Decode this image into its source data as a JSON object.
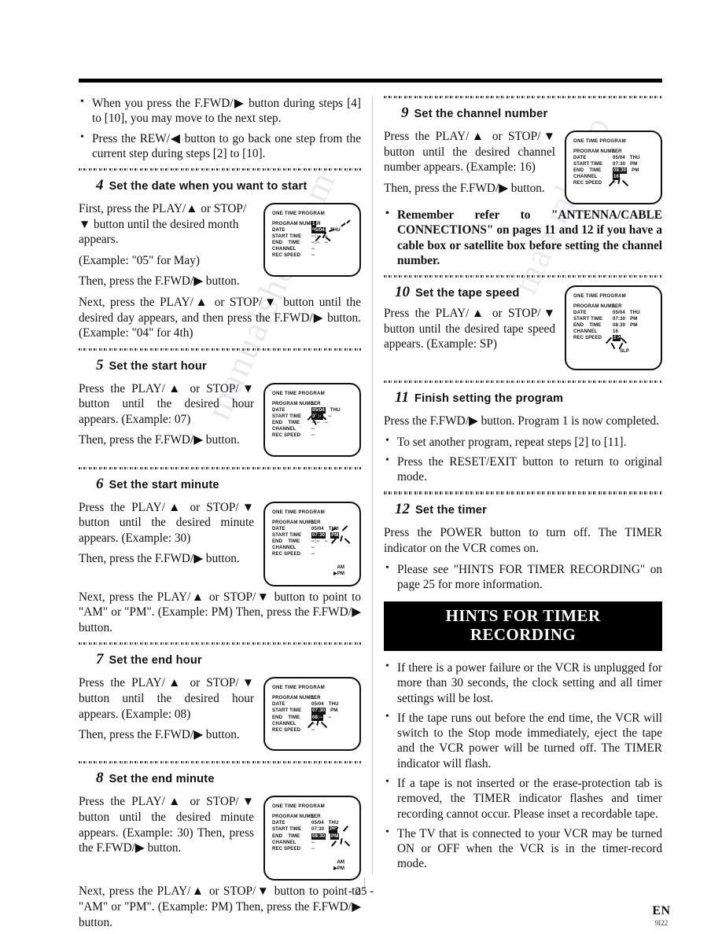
{
  "page": {
    "number": "- 25 -",
    "lang_code": "EN",
    "doc_code": "9I22"
  },
  "left_column": {
    "intro_bullets": [
      "When you press the F.FWD/▶ button during steps [4] to [10], you may move to the next step.",
      "Press the REW/◀ button to go back one step from the current step during steps [2] to [10]."
    ],
    "step4": {
      "num": "4",
      "title": "Set the date when you want to start",
      "para1": "First, press the PLAY/▲ or STOP/▼ button until the desired month appears.",
      "para2": "(Example: \"05\" for May)",
      "para3": "Then, press the F.FWD/▶ button.",
      "para4": "Next, press the PLAY/▲ or STOP/▼ button until the desired day appears, and then press the F.FWD/▶ button. (Example: \"04\" for 4th)"
    },
    "step5": {
      "num": "5",
      "title": "Set the start hour",
      "para1": "Press the PLAY/▲ or STOP/▼ button until the desired hour appears. (Example: 07)",
      "para2": "Then, press the F.FWD/▶ button."
    },
    "step6": {
      "num": "6",
      "title": "Set the start minute",
      "para1": "Press the PLAY/▲ or STOP/▼ button until the desired minute appears. (Example: 30)",
      "para2": "Then, press the F.FWD/▶ button.",
      "para3": "Next, press the PLAY/▲ or STOP/▼ button to point to \"AM\" or \"PM\". (Example: PM) Then, press the F.FWD/▶ button."
    },
    "step7": {
      "num": "7",
      "title": "Set the end hour",
      "para1": "Press the PLAY/▲ or STOP/▼ button until the desired hour appears. (Example: 08)",
      "para2": "Then, press the F.FWD/▶ button."
    },
    "step8": {
      "num": "8",
      "title": "Set the end minute",
      "para1": "Press the PLAY/▲ or STOP/▼ button until the desired minute appears. (Example: 30) Then, press the F.FWD/▶ button.",
      "para2": "Next, press the PLAY/▲ or STOP/▼ button to point to \"AM\" or \"PM\". (Example: PM) Then, press the F.FWD/▶ button."
    }
  },
  "right_column": {
    "step9": {
      "num": "9",
      "title": "Set the channel number",
      "para1": "Press the PLAY/▲ or STOP/▼ button until the desired channel number appears. (Example: 16)",
      "para2": "Then, press the F.FWD/▶ button.",
      "note": "Remember refer to \"ANTENNA/CABLE CONNECTIONS\" on pages 11 and 12 if you have a cable box or satellite box before setting the channel number."
    },
    "step10": {
      "num": "10",
      "title": "Set the tape speed",
      "para1": "Press the PLAY/▲ or STOP/▼ button until the desired tape speed appears. (Example: SP)"
    },
    "step11": {
      "num": "11",
      "title": "Finish setting the program",
      "para1": "Press the F.FWD/▶ button. Program 1 is now completed.",
      "bullets": [
        "To set another program, repeat steps [2] to [11].",
        "Press the RESET/EXIT button to return to original mode."
      ]
    },
    "step12": {
      "num": "12",
      "title": "Set the timer",
      "para1": "Press the POWER button to turn off. The TIMER indicator on the VCR comes on.",
      "bullets": [
        "Please see \"HINTS FOR TIMER RECORDING\" on page 25 for more information."
      ]
    },
    "hints": {
      "banner_line1": "HINTS FOR TIMER",
      "banner_line2": "RECORDING",
      "bullets": [
        "If there is a power failure or the VCR is unplugged for more than 30 seconds, the clock setting and all timer settings will be lost.",
        "If the tape runs out before the end time, the VCR will switch to the Stop mode immediately, eject the tape and the VCR power will be turned off. The TIMER indicator will flash.",
        "If a tape is not inserted or the erase-protection tab is removed, the TIMER indicator flashes and timer recording cannot occur. Please inset a recordable tape.",
        "The TV that is connected to your VCR may be turned ON or OFF when the VCR is in the timer-record mode."
      ]
    }
  },
  "osd_labels": {
    "title": "ONE TIME PROGRAM",
    "program_number": "PROGRAM NUMBER",
    "date": "DATE",
    "start_time": "START TIME",
    "end_time": "END    TIME",
    "channel": "CHANNEL",
    "rec_speed": "REC SPEED",
    "am": "AM",
    "pm": "PM",
    "slp": "SLP"
  },
  "osd_screens": {
    "step4": {
      "program_number": "1",
      "date": "05/04",
      "weekday": "THU",
      "start_time": "--:--",
      "start_ampm": "--",
      "end_time": "--:--",
      "end_ampm": "--",
      "channel": "--",
      "rec_speed": "--"
    },
    "step5": {
      "program_number": "1",
      "date": "05/04",
      "weekday": "THU",
      "start_time": "07:--",
      "start_ampm": "--",
      "end_time": "--:--",
      "end_ampm": "--",
      "channel": "--",
      "rec_speed": "--"
    },
    "step6": {
      "program_number": "1",
      "date": "05/04",
      "weekday": "THU",
      "start_time": "07:30",
      "start_ampm": "PM",
      "end_time": "--:--",
      "end_ampm": "--",
      "channel": "--",
      "rec_speed": "--",
      "am": "AM",
      "pm": "PM"
    },
    "step7": {
      "program_number": "1",
      "date": "05/04",
      "weekday": "THU",
      "start_time": "07:30",
      "start_ampm": "PM",
      "end_time": "08:--",
      "end_ampm": "--",
      "channel": "--",
      "rec_speed": "--"
    },
    "step8": {
      "program_number": "1",
      "date": "05/04",
      "weekday": "THU",
      "start_time": "07:30",
      "start_ampm": "PM",
      "end_time": "08:30",
      "end_ampm": "PM",
      "channel": "--",
      "rec_speed": "--",
      "am": "AM",
      "pm": "PM"
    },
    "step9": {
      "program_number": "1",
      "date": "05/04",
      "weekday": "THU",
      "start_time": "07:30",
      "start_ampm": "PM",
      "end_time": "08:30",
      "end_ampm": "PM",
      "channel": "16",
      "rec_speed": "--"
    },
    "step10": {
      "program_number": "1",
      "date": "05/04",
      "weekday": "THU",
      "start_time": "07:30",
      "start_ampm": "PM",
      "end_time": "08:30",
      "end_ampm": "PM",
      "channel": "16",
      "rec_speed": "SP",
      "slp": "SLP"
    }
  },
  "watermark": {
    "text1": "manualshop.com",
    "text2": "manualshop"
  }
}
